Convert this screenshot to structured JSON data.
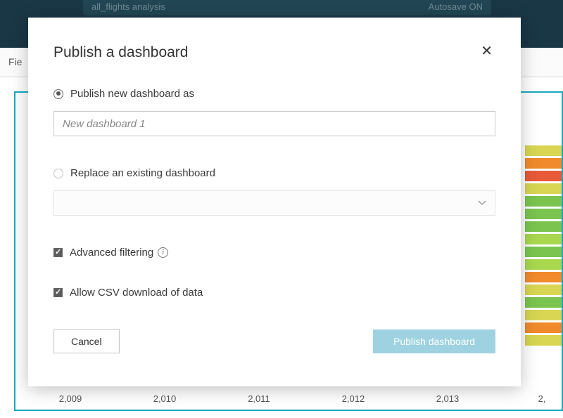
{
  "bg": {
    "analysis_name": "all_flights analysis",
    "autosave": "Autosave ON",
    "toolbar_left": "Fie",
    "axis": [
      "2,009",
      "2,010",
      "2,011",
      "2,012",
      "2,013",
      "2,"
    ]
  },
  "modal": {
    "title": "Publish a dashboard",
    "options": {
      "publish_new_label": "Publish new dashboard as",
      "new_dashboard_value": "New dashboard 1",
      "replace_label": "Replace an existing dashboard",
      "advanced_filtering_label": "Advanced filtering",
      "allow_csv_label": "Allow CSV download of data"
    },
    "buttons": {
      "cancel": "Cancel",
      "publish": "Publish dashboard"
    }
  }
}
